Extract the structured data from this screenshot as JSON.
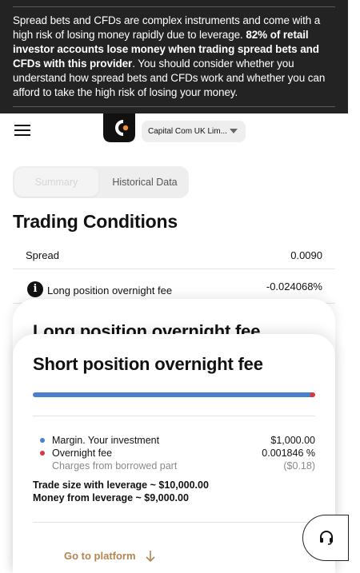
{
  "risk_warning": {
    "text_before": "Spread bets and CFDs are complex instruments and come with a high risk of losing money rapidly due to leverage. ",
    "text_bold": "82% of retail investor accounts lose money when trading spread bets and CFDs with this provider",
    "text_after": ". You should consider whether you understand how spread bets and CFDs work and whether you can afford to take the high risk of losing your money."
  },
  "header": {
    "menu_icon": "hamburger-icon",
    "logo": "capital-com-logo",
    "entity_select": {
      "value": "Capital Com UK Lim..."
    }
  },
  "tabs": [
    {
      "label": "Summary",
      "active": true
    },
    {
      "label": "Historical Data",
      "active": false
    }
  ],
  "trading_conditions": {
    "title": "Trading Conditions",
    "rows": [
      {
        "label": "Spread",
        "value": "0.0090"
      },
      {
        "label": "Long position overnight fee",
        "value": "-0.024068%",
        "icon": "info-icon"
      }
    ]
  },
  "back_card": {
    "title": "Long position overnight fee"
  },
  "front_card": {
    "title": "Short position overnight fee",
    "bar": {
      "margin_fraction": 0.9836,
      "fee_fraction": 0.0164,
      "margin_color": "#4a7fd0",
      "fee_color": "#d6393f"
    },
    "legend": [
      {
        "label": "Margin. Your investment",
        "value": "$1,000.00",
        "dot_color": "#4a7fd0"
      },
      {
        "label": "Overnight fee",
        "value": "0.001846 %",
        "dot_color": "#d6393f"
      },
      {
        "label": "Charges from borrowed part",
        "value": "($0.18)"
      }
    ],
    "trade_size": "Trade size with leverage ~ $10,000.00",
    "money_from_leverage": "Money from leverage ~ $9,000.00",
    "go_button": "Go to platform"
  },
  "support": {
    "icon": "headset-icon"
  }
}
